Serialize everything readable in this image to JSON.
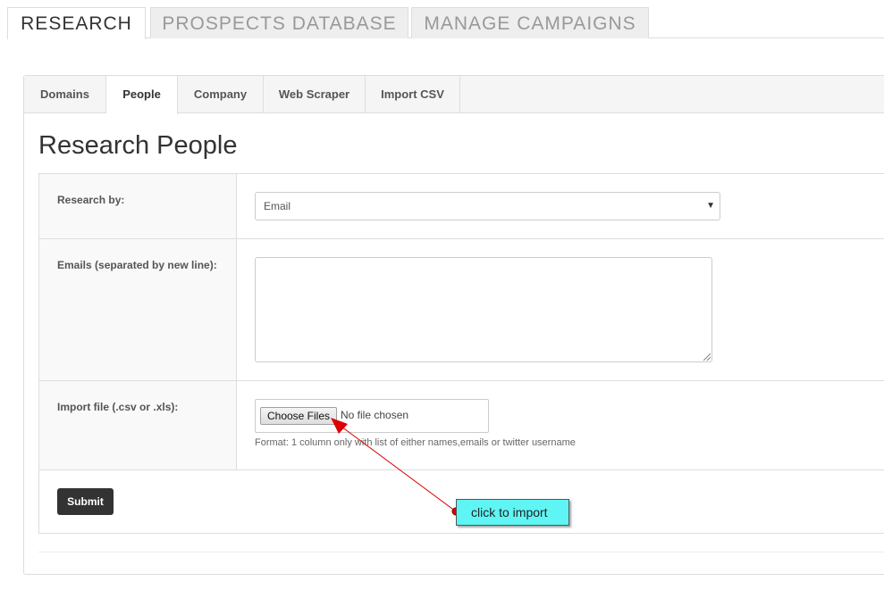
{
  "top_tabs": {
    "research": "RESEARCH",
    "prospects": "PROSPECTS DATABASE",
    "campaigns": "MANAGE CAMPAIGNS"
  },
  "sub_tabs": {
    "domains": "Domains",
    "people": "People",
    "company": "Company",
    "web_scraper": "Web Scraper",
    "import_csv": "Import CSV"
  },
  "page_title": "Research People",
  "form": {
    "research_by_label": "Research by:",
    "research_by_value": "Email",
    "emails_label": "Emails (separated by new line):",
    "emails_value": "",
    "import_label": "Import file (.csv or .xls):",
    "choose_files_label": "Choose Files",
    "file_status": "No file chosen",
    "help_text": "Format: 1 column only with list of either names,emails or twitter username",
    "submit_label": "Submit"
  },
  "annotation": {
    "text": "click to import",
    "color": "#5ff5f5",
    "arrow_color": "#dd0000"
  }
}
